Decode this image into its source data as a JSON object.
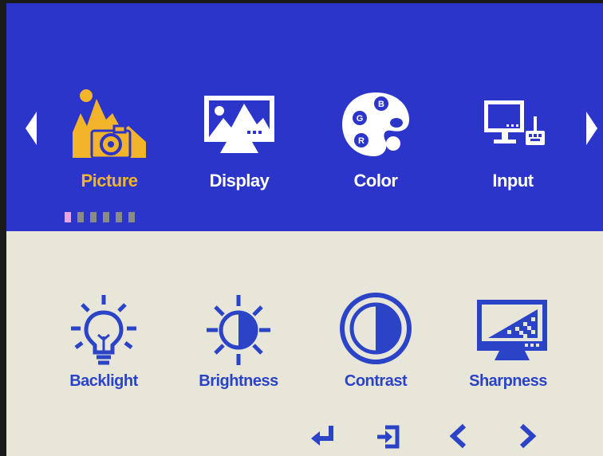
{
  "categories": [
    {
      "label": "Picture",
      "icon": "picture-icon",
      "active": true
    },
    {
      "label": "Display",
      "icon": "display-icon",
      "active": false
    },
    {
      "label": "Color",
      "icon": "color-palette-icon",
      "active": false
    },
    {
      "label": "Input",
      "icon": "input-icon",
      "active": false
    }
  ],
  "palette_letters": {
    "b": "B",
    "g": "G",
    "r": "R"
  },
  "page_indicator": {
    "total": 6,
    "current": 1
  },
  "sub_items": [
    {
      "label": "Backlight",
      "icon": "lightbulb-icon"
    },
    {
      "label": "Brightness",
      "icon": "brightness-icon"
    },
    {
      "label": "Contrast",
      "icon": "contrast-icon"
    },
    {
      "label": "Sharpness",
      "icon": "sharpness-icon"
    }
  ],
  "nav_keys": [
    "enter-icon",
    "exit-icon",
    "left-icon",
    "right-icon"
  ],
  "colors": {
    "top_panel": "#2b35c9",
    "bottom_panel": "#e8e6d9",
    "active_label": "#f2b42b",
    "sub_item": "#2b43c6",
    "active_dot": "#e6a6e6"
  }
}
